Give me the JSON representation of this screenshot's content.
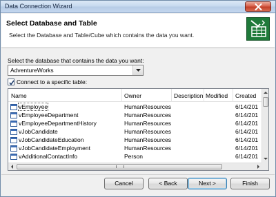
{
  "window": {
    "title": "Data Connection Wizard",
    "close_icon": "close-x-icon"
  },
  "header": {
    "title": "Select Database and Table",
    "subtitle": "Select the Database and Table/Cube which contains the data you want.",
    "icon": "database-table-wizard-icon",
    "icon_color": "#1f7a3a"
  },
  "database": {
    "label": "Select the database that contains the data you want:",
    "selected": "AdventureWorks"
  },
  "connect_checkbox": {
    "label": "Connect to a specific table:",
    "checked": true
  },
  "table": {
    "columns": [
      "Name",
      "Owner",
      "Description",
      "Modified",
      "Created"
    ],
    "rows": [
      {
        "name": "vEmployee",
        "owner": "HumanResources",
        "description": "",
        "modified": "",
        "created": "6/14/201",
        "selected": true
      },
      {
        "name": "vEmployeeDepartment",
        "owner": "HumanResources",
        "description": "",
        "modified": "",
        "created": "6/14/201"
      },
      {
        "name": "vEmployeeDepartmentHistory",
        "owner": "HumanResources",
        "description": "",
        "modified": "",
        "created": "6/14/201"
      },
      {
        "name": "vJobCandidate",
        "owner": "HumanResources",
        "description": "",
        "modified": "",
        "created": "6/14/201"
      },
      {
        "name": "vJobCandidateEducation",
        "owner": "HumanResources",
        "description": "",
        "modified": "",
        "created": "6/14/201"
      },
      {
        "name": "vJobCandidateEmployment",
        "owner": "HumanResources",
        "description": "",
        "modified": "",
        "created": "6/14/201"
      },
      {
        "name": "vAdditionalContactInfo",
        "owner": "Person",
        "description": "",
        "modified": "",
        "created": "6/14/201"
      }
    ]
  },
  "buttons": {
    "cancel": "Cancel",
    "back": "< Back",
    "next": "Next >",
    "finish": "Finish"
  }
}
